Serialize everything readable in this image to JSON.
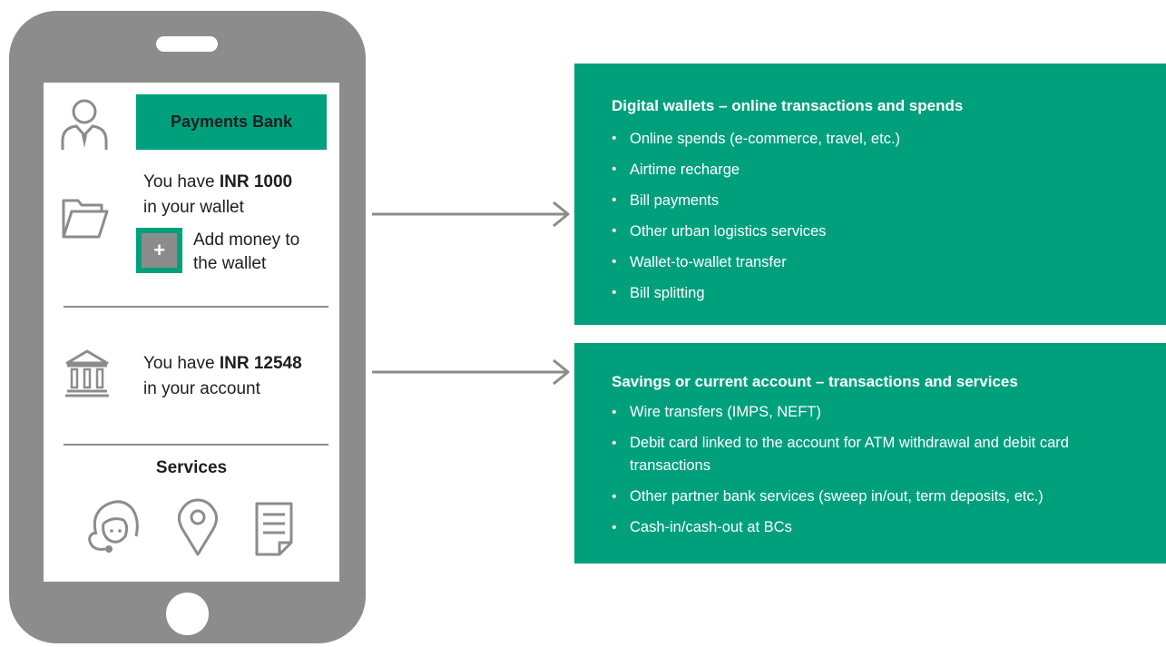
{
  "phone": {
    "header": {
      "badge_label": "Payments Bank"
    },
    "wallet": {
      "prefix": "You have ",
      "amount": "INR 1000",
      "suffix": "in your wallet",
      "add_money_label_line1": "Add money to",
      "add_money_label_line2": "the wallet",
      "add_icon_glyph": "+"
    },
    "account": {
      "prefix": "You have ",
      "amount": "INR 12548",
      "suffix": "in your account"
    },
    "services": {
      "title": "Services",
      "icons": [
        "customer-support-icon",
        "location-pin-icon",
        "document-icon"
      ]
    },
    "icons": {
      "user": "user-icon",
      "wallet": "folder-icon",
      "bank": "bank-icon"
    }
  },
  "panels": [
    {
      "title": "Digital wallets – online transactions and spends",
      "items": [
        "Online spends (e-commerce, travel, etc.)",
        "Airtime recharge",
        "Bill payments",
        "Other urban logistics services",
        "Wallet-to-wallet transfer",
        "Bill splitting"
      ]
    },
    {
      "title": "Savings or current account – transactions and services",
      "items": [
        "Wire transfers (IMPS, NEFT)",
        "Debit card linked to the account for ATM withdrawal and debit card transactions",
        "Other partner bank services (sweep in/out, term deposits, etc.)",
        "Cash-in/cash-out at BCs"
      ]
    }
  ],
  "colors": {
    "accent": "#00a07d",
    "phone_body": "#8c8c8c",
    "text_dark": "#1e1e1e",
    "bullet": "#f2e6c4"
  }
}
